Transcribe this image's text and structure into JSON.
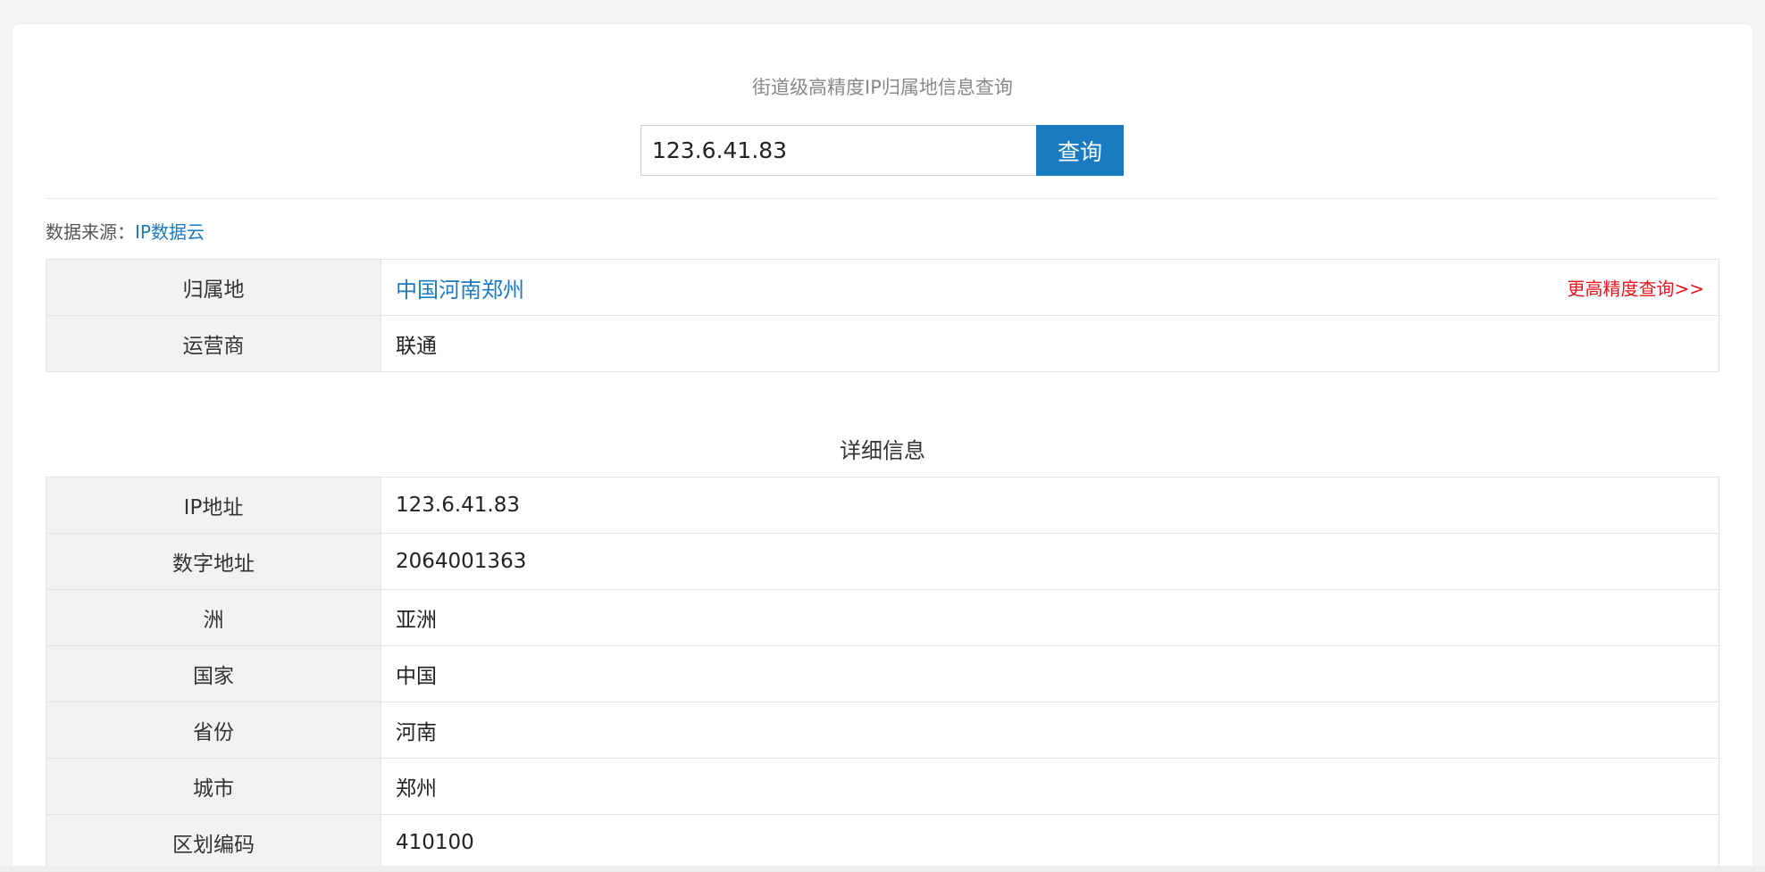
{
  "header": {
    "subtitle": "街道级高精度IP归属地信息查询"
  },
  "search": {
    "value": "123.6.41.83",
    "button_label": "查询"
  },
  "source": {
    "prefix": "数据来源：",
    "link_text": "IP数据云"
  },
  "summary": {
    "location_label": "归属地",
    "location_value": "中国河南郑州",
    "precision_link": "更高精度查询>>",
    "isp_label": "运营商",
    "isp_value": "联通"
  },
  "details": {
    "title": "详细信息",
    "rows": [
      {
        "label": "IP地址",
        "value": "123.6.41.83"
      },
      {
        "label": "数字地址",
        "value": "2064001363"
      },
      {
        "label": "洲",
        "value": "亚洲"
      },
      {
        "label": "国家",
        "value": "中国"
      },
      {
        "label": "省份",
        "value": "河南"
      },
      {
        "label": "城市",
        "value": "郑州"
      },
      {
        "label": "区划编码",
        "value": "410100"
      }
    ]
  },
  "colors": {
    "accent": "#1a7bc1",
    "highlight_red": "#e8151b",
    "label_bg": "#f2f2f2"
  }
}
